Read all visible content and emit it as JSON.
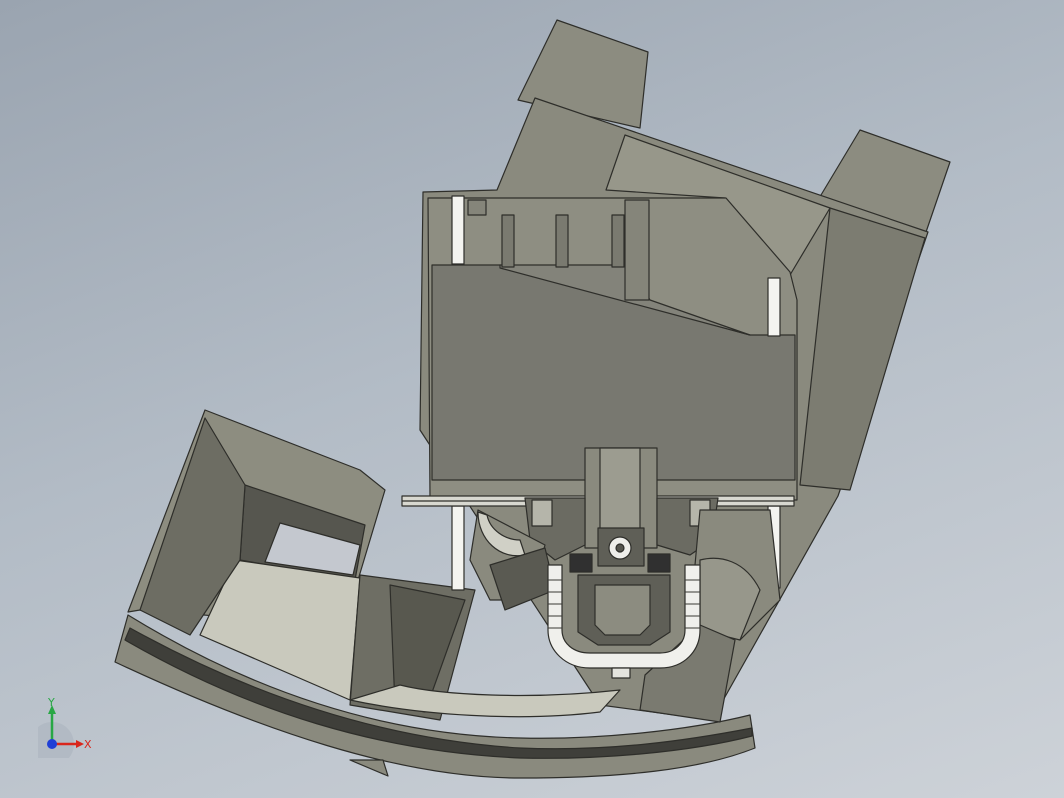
{
  "viewport": {
    "background_top": "#9aa4b0",
    "background_bottom": "#cdd2d8"
  },
  "model": {
    "body_color": "#8d8d80",
    "dark_color": "#4c4c46",
    "light_color": "#c9c9bd",
    "rail_color": "#f3f3f0"
  },
  "triad": {
    "x_label": "X",
    "y_label": "Y",
    "x_color": "#d9261c",
    "y_color": "#28a745",
    "z_color": "#1f3fd6"
  }
}
